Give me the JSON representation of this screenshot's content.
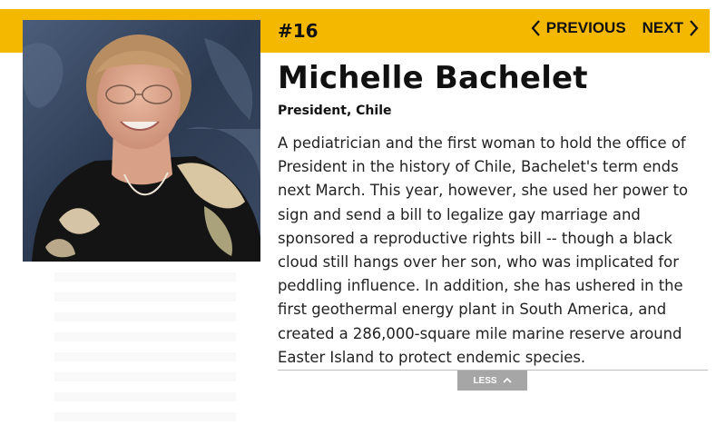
{
  "header": {
    "rank": "#16",
    "previous_label": "PREVIOUS",
    "next_label": "NEXT",
    "accent_color": "#f5b800"
  },
  "profile": {
    "name": "Michelle Bachelet",
    "role": "President, Chile",
    "bio": "A pediatrician and the first woman to hold the office of President in the history of Chile, Bachelet's term ends next March. This year, however, she used her power to sign and send a bill to legalize gay marriage and sponsored a reproductive rights bill -- though a black cloud still hangs over her son, who was implicated for peddling influence. In addition, she has ushered in the first geothermal energy plant in South America, and created a 286,000-square mile marine reserve around Easter Island to protect endemic species."
  },
  "controls": {
    "less_label": "LESS"
  },
  "icons": [
    "chevron-left-icon",
    "chevron-right-icon",
    "chevron-up-icon"
  ]
}
